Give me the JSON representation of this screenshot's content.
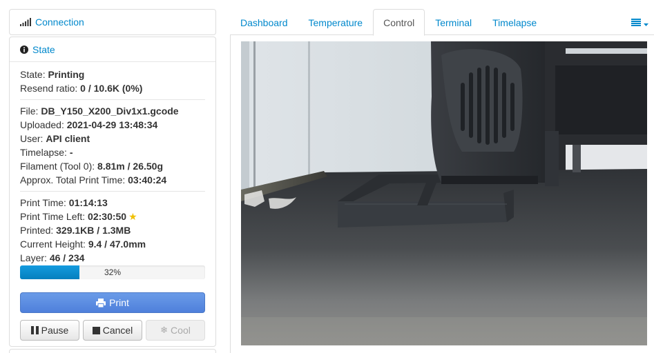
{
  "sidebar": {
    "connection": {
      "title": "Connection",
      "icon": "signal-icon"
    },
    "state": {
      "title": "State",
      "icon": "info-circle-icon",
      "rows": [
        {
          "label": "State: ",
          "value": "Printing"
        },
        {
          "label": "Resend ratio: ",
          "value": "0 / 10.6K (0%)"
        },
        {
          "label": "File: ",
          "value": "DB_Y150_X200_Div1x1.gcode"
        },
        {
          "label": "Uploaded: ",
          "value": "2021-04-29 13:48:34"
        },
        {
          "label": "User: ",
          "value": "API client"
        },
        {
          "label": "Timelapse: ",
          "value": "-"
        },
        {
          "label": "Filament (Tool 0): ",
          "value": "8.81m / 26.50g"
        },
        {
          "label": "Approx. Total Print Time: ",
          "value": "03:40:24"
        },
        {
          "label": "Print Time: ",
          "value": "01:14:13"
        },
        {
          "label": "Print Time Left: ",
          "value": "02:30:50"
        },
        {
          "label": "Printed: ",
          "value": "329.1KB / 1.3MB"
        },
        {
          "label": "Current Height: ",
          "value": "9.4 / 47.0mm"
        },
        {
          "label": "Layer: ",
          "value": "46 / 234"
        }
      ],
      "progress": {
        "text": "32%",
        "fraction": 0.32,
        "color": "#0e8fd2"
      },
      "buttons": {
        "print": "Print",
        "pause": "Pause",
        "cancel": "Cancel",
        "cool": "Cool"
      }
    }
  },
  "tabs": [
    {
      "label": "Dashboard",
      "active": false
    },
    {
      "label": "Temperature",
      "active": false
    },
    {
      "label": "Control",
      "active": true
    },
    {
      "label": "Terminal",
      "active": false
    },
    {
      "label": "Timelapse",
      "active": false
    }
  ],
  "menu_icon": "list-icon",
  "colors": {
    "link": "#0088cc",
    "print_button": "#5b8de0",
    "star": "#f0c000"
  }
}
